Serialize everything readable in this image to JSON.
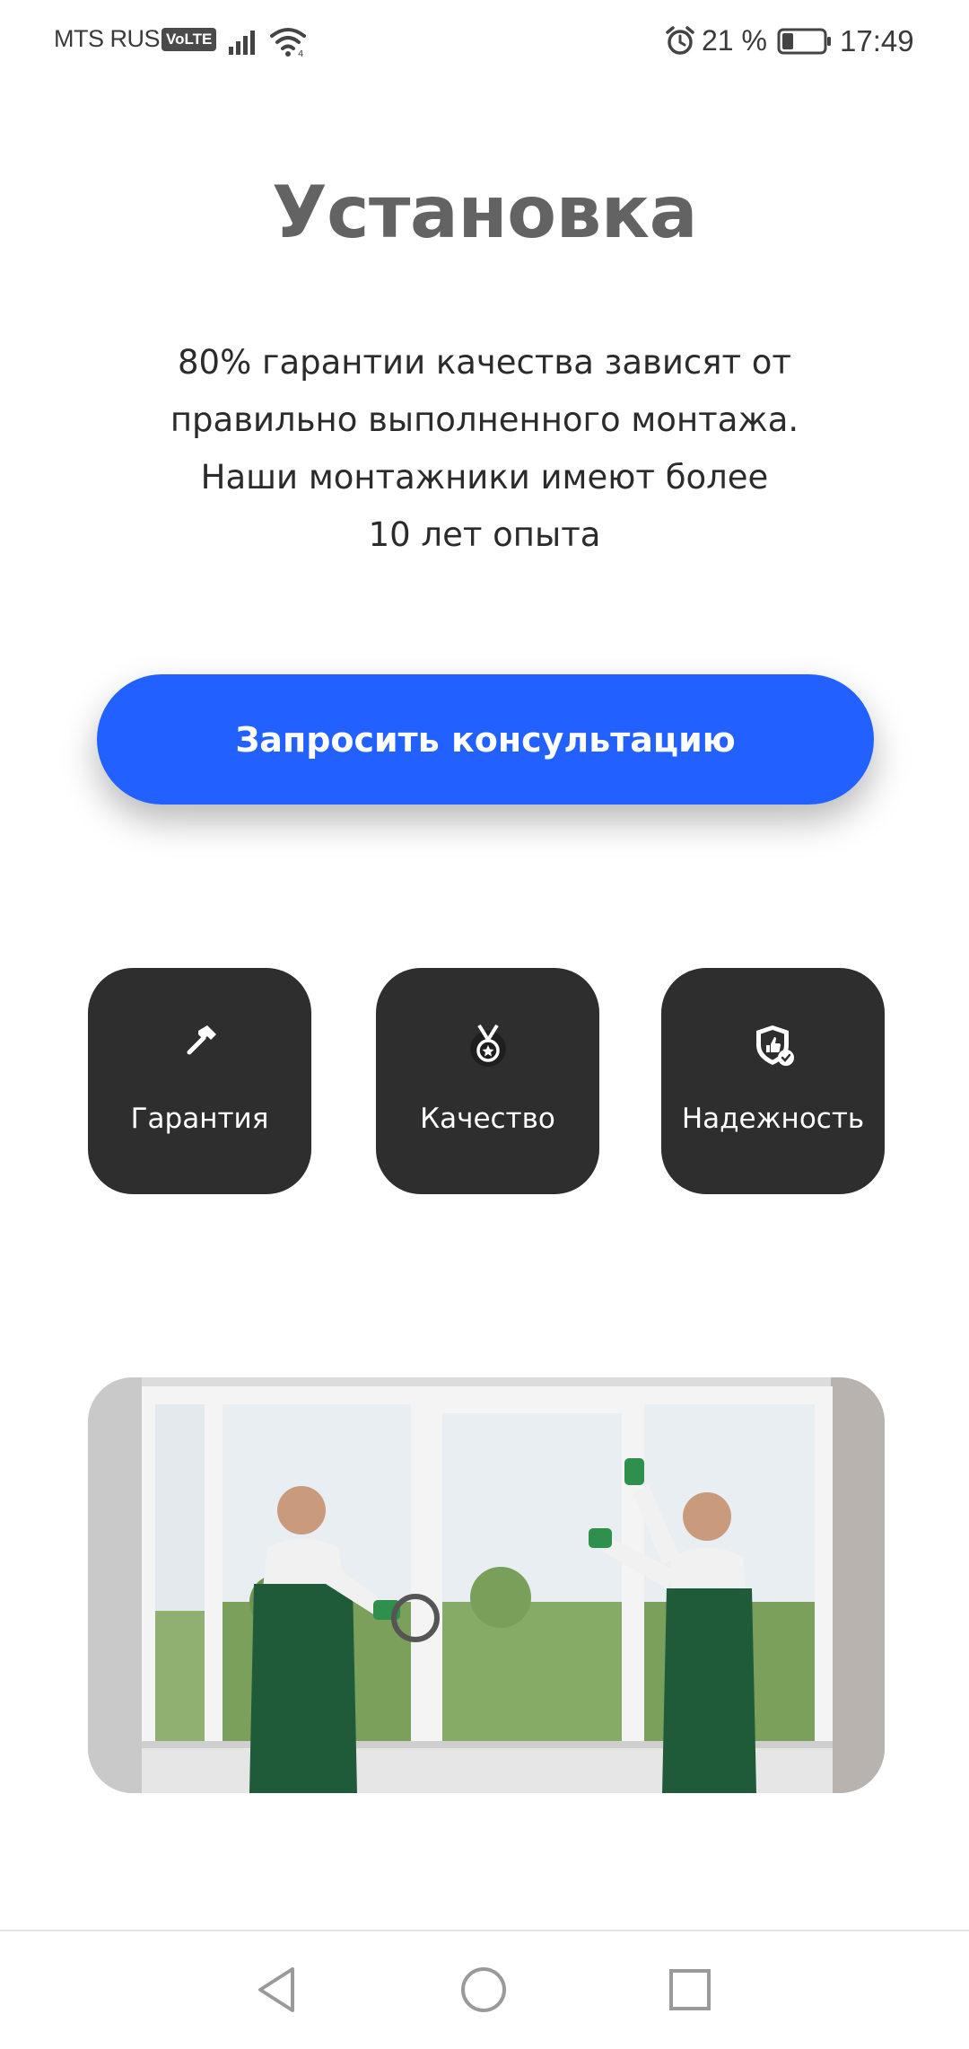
{
  "status_bar": {
    "carrier": "MTS RUS",
    "volte": "VoLTE",
    "battery_percent": "21 %",
    "time": "17:49",
    "icons": [
      "signal-icon",
      "wifi-icon",
      "alarm-icon",
      "battery-icon"
    ]
  },
  "main": {
    "title": "Установка",
    "intro_lines": [
      "80% гарантии качества зависят от",
      "правильно выполненного монтажа.",
      "Наши монтажники имеют более",
      "10 лет опыта"
    ],
    "cta_label": "Запросить консультацию",
    "features": [
      {
        "label": "Гарантия",
        "icon": "hammer-icon"
      },
      {
        "label": "Качество",
        "icon": "medal-icon"
      },
      {
        "label": "Надежность",
        "icon": "shield-icon"
      }
    ],
    "photo_icon": "installers-photo"
  },
  "nav_bar": {
    "icons": [
      "back-icon",
      "home-icon",
      "recent-apps-icon"
    ]
  },
  "colors": {
    "accent": "#2261ff",
    "feature_card": "#2e2e2e",
    "title": "#636363",
    "text": "#2b2b2b"
  }
}
